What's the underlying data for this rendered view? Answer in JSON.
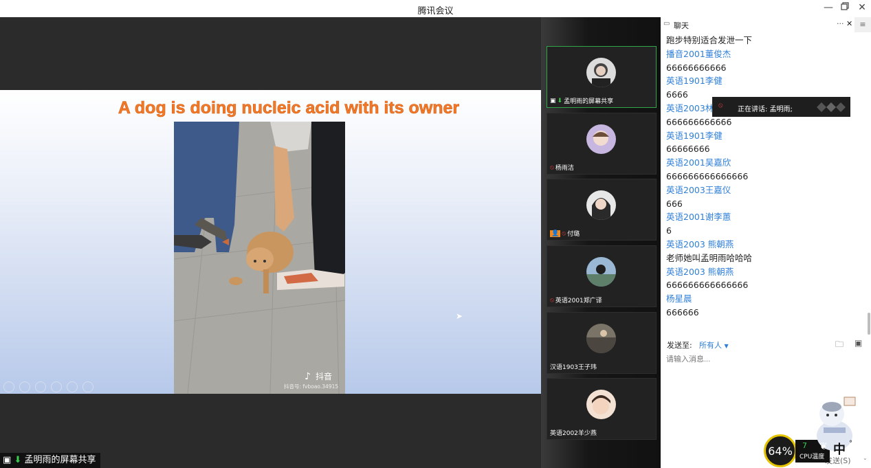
{
  "window": {
    "title": "腾讯会议"
  },
  "main": {
    "slide_title": "A dog is doing nucleic acid with its owner",
    "watermark": {
      "brand": "抖音",
      "account": "抖音号: fvboao.34915"
    },
    "share_label": "孟明雨的屏幕共享"
  },
  "participants": [
    {
      "name": "孟明雨的屏幕共享",
      "active": true,
      "mic": "on",
      "screen_share": true
    },
    {
      "name": "杨雨洁",
      "mic": "muted"
    },
    {
      "name": "付璐",
      "mic": "muted",
      "badge": true
    },
    {
      "name": "英语2001郑广译",
      "mic": "muted"
    },
    {
      "name": "汉语1903王子玮"
    },
    {
      "name": "英语2002羊少燕"
    }
  ],
  "chat": {
    "title": "聊天",
    "messages": [
      {
        "text": "跑步特别适合发泄一下"
      },
      {
        "name": "播音2001董俊杰",
        "text": "66666666666"
      },
      {
        "name": "英语1901李健",
        "text": "6666"
      },
      {
        "name": "英语2003林",
        "text": "666666666666"
      },
      {
        "name": "英语1901李健",
        "text": "66666666"
      },
      {
        "name": "英语2001吴嘉欣",
        "text": "666666666666666"
      },
      {
        "name": "英语2003王嘉仪",
        "text": "666"
      },
      {
        "name": "英语2001谢李蕙",
        "text": "6"
      },
      {
        "name": "英语2003 熊朝燕",
        "text": "老师她叫孟明雨哈哈哈"
      },
      {
        "name": "英语2003 熊朝燕",
        "text": "666666666666666"
      },
      {
        "name": "杨星晨",
        "text": "666666"
      }
    ],
    "speaking": "正在讲话: 孟明雨;",
    "send_to_label": "发送至:",
    "send_to_value": "所有人",
    "input_placeholder": "请输入消息...",
    "send_button": "发送(S)"
  },
  "overlay": {
    "cpu_percent": "64%",
    "cpu_temp_value": "7",
    "cpu_temp_label": "CPU温度",
    "ime": "中"
  },
  "colors": {
    "accent": "#2f7fd8",
    "active_border": "#2fa74a",
    "slide_title": "#f07a2a"
  }
}
